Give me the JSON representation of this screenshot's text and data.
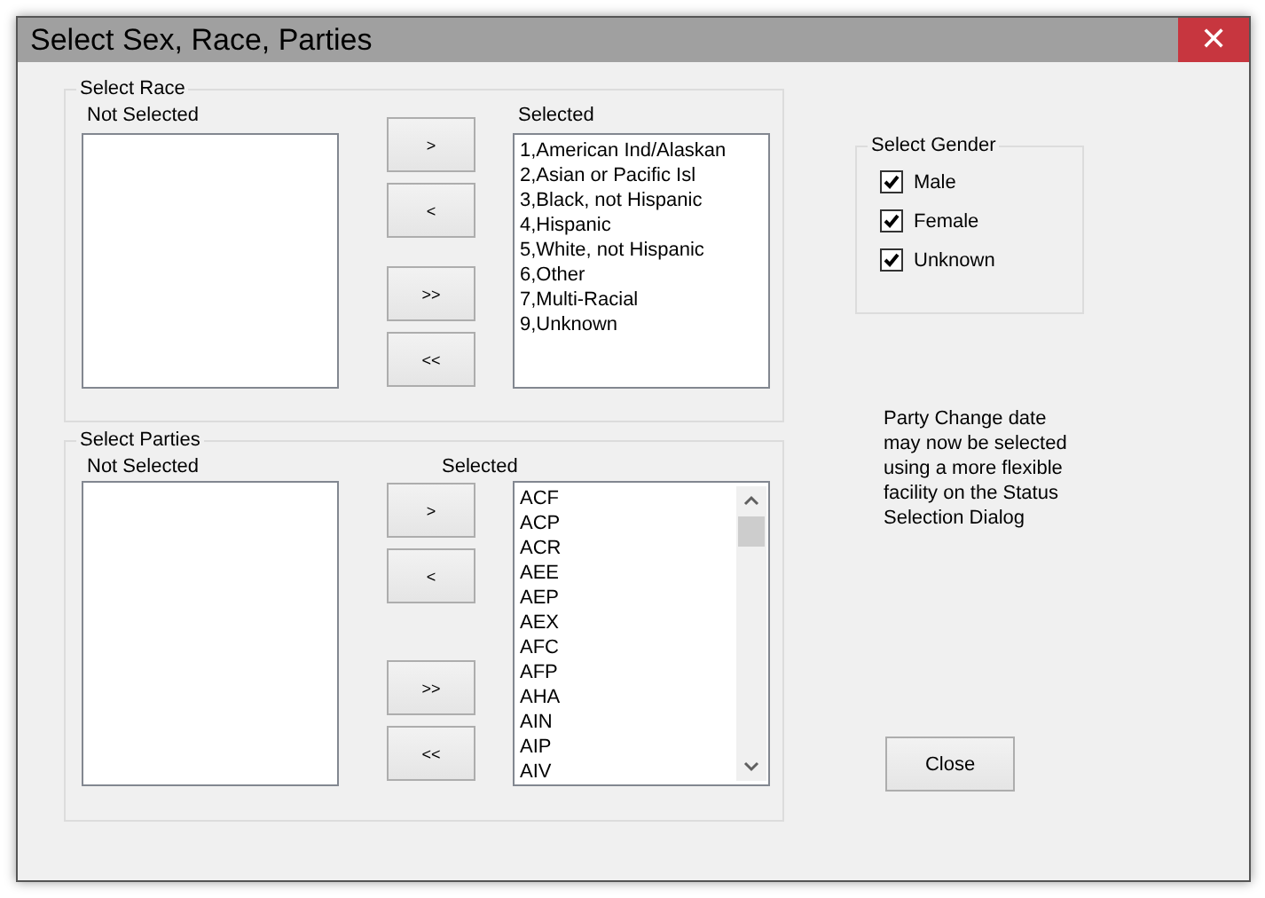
{
  "window": {
    "title": "Select Sex, Race, Parties",
    "close": "✕"
  },
  "groups": [
    {
      "legend": "Select Race",
      "not_selected_label": "Not Selected",
      "selected_label": "Selected",
      "selected_items": [
        "1,American Ind/Alaskan",
        "2,Asian or Pacific Isl",
        "3,Black, not Hispanic",
        "4,Hispanic",
        "5,White, not Hispanic",
        "6,Other",
        "7,Multi-Racial",
        "9,Unknown"
      ],
      "buttons": [
        ">",
        "<",
        ">>",
        "<<"
      ]
    },
    {
      "legend": "Select Parties",
      "not_selected_label": "Not Selected",
      "selected_label": "Selected",
      "selected_items": [
        "ACF",
        "ACP",
        "ACR",
        "AEE",
        "AEP",
        "AEX",
        "AFC",
        "AFP",
        "AHA",
        "AIN",
        "AIP",
        "AIV"
      ],
      "buttons": [
        ">",
        "<",
        ">>",
        "<<"
      ],
      "scrollbar": true
    }
  ],
  "gender": {
    "legend": "Select Gender",
    "options": [
      {
        "label": "Male",
        "checked": true
      },
      {
        "label": "Female",
        "checked": true
      },
      {
        "label": "Unknown",
        "checked": true
      }
    ]
  },
  "note": "Party Change date may now be selected using a more flexible facility on the Status Selection Dialog",
  "close_button": "Close"
}
